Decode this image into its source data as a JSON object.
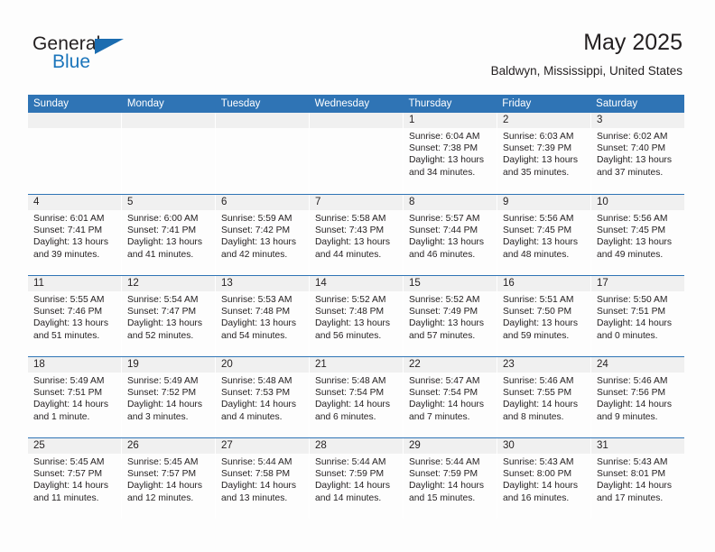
{
  "brand": {
    "line1": "General",
    "line2": "Blue",
    "triangle_color": "#1b6cb0",
    "text_color": "#231f20",
    "accent_color": "#1b75bb"
  },
  "header": {
    "title": "May 2025",
    "subtitle": "Baldwyn, Mississippi, United States"
  },
  "theme": {
    "header_bar_color": "#2f74b5",
    "day_number_band_color": "#f0f0f0",
    "page_background": "#fdfdfd",
    "text_color": "#231f20"
  },
  "weekdays": [
    "Sunday",
    "Monday",
    "Tuesday",
    "Wednesday",
    "Thursday",
    "Friday",
    "Saturday"
  ],
  "weeks": [
    [
      {
        "day": "",
        "empty": true,
        "sunrise": "",
        "sunset": "",
        "daylight_line1": "",
        "daylight_line2": ""
      },
      {
        "day": "",
        "empty": true,
        "sunrise": "",
        "sunset": "",
        "daylight_line1": "",
        "daylight_line2": ""
      },
      {
        "day": "",
        "empty": true,
        "sunrise": "",
        "sunset": "",
        "daylight_line1": "",
        "daylight_line2": ""
      },
      {
        "day": "",
        "empty": true,
        "sunrise": "",
        "sunset": "",
        "daylight_line1": "",
        "daylight_line2": ""
      },
      {
        "day": "1",
        "empty": false,
        "sunrise": "Sunrise: 6:04 AM",
        "sunset": "Sunset: 7:38 PM",
        "daylight_line1": "Daylight: 13 hours",
        "daylight_line2": "and 34 minutes."
      },
      {
        "day": "2",
        "empty": false,
        "sunrise": "Sunrise: 6:03 AM",
        "sunset": "Sunset: 7:39 PM",
        "daylight_line1": "Daylight: 13 hours",
        "daylight_line2": "and 35 minutes."
      },
      {
        "day": "3",
        "empty": false,
        "sunrise": "Sunrise: 6:02 AM",
        "sunset": "Sunset: 7:40 PM",
        "daylight_line1": "Daylight: 13 hours",
        "daylight_line2": "and 37 minutes."
      }
    ],
    [
      {
        "day": "4",
        "empty": false,
        "sunrise": "Sunrise: 6:01 AM",
        "sunset": "Sunset: 7:41 PM",
        "daylight_line1": "Daylight: 13 hours",
        "daylight_line2": "and 39 minutes."
      },
      {
        "day": "5",
        "empty": false,
        "sunrise": "Sunrise: 6:00 AM",
        "sunset": "Sunset: 7:41 PM",
        "daylight_line1": "Daylight: 13 hours",
        "daylight_line2": "and 41 minutes."
      },
      {
        "day": "6",
        "empty": false,
        "sunrise": "Sunrise: 5:59 AM",
        "sunset": "Sunset: 7:42 PM",
        "daylight_line1": "Daylight: 13 hours",
        "daylight_line2": "and 42 minutes."
      },
      {
        "day": "7",
        "empty": false,
        "sunrise": "Sunrise: 5:58 AM",
        "sunset": "Sunset: 7:43 PM",
        "daylight_line1": "Daylight: 13 hours",
        "daylight_line2": "and 44 minutes."
      },
      {
        "day": "8",
        "empty": false,
        "sunrise": "Sunrise: 5:57 AM",
        "sunset": "Sunset: 7:44 PM",
        "daylight_line1": "Daylight: 13 hours",
        "daylight_line2": "and 46 minutes."
      },
      {
        "day": "9",
        "empty": false,
        "sunrise": "Sunrise: 5:56 AM",
        "sunset": "Sunset: 7:45 PM",
        "daylight_line1": "Daylight: 13 hours",
        "daylight_line2": "and 48 minutes."
      },
      {
        "day": "10",
        "empty": false,
        "sunrise": "Sunrise: 5:56 AM",
        "sunset": "Sunset: 7:45 PM",
        "daylight_line1": "Daylight: 13 hours",
        "daylight_line2": "and 49 minutes."
      }
    ],
    [
      {
        "day": "11",
        "empty": false,
        "sunrise": "Sunrise: 5:55 AM",
        "sunset": "Sunset: 7:46 PM",
        "daylight_line1": "Daylight: 13 hours",
        "daylight_line2": "and 51 minutes."
      },
      {
        "day": "12",
        "empty": false,
        "sunrise": "Sunrise: 5:54 AM",
        "sunset": "Sunset: 7:47 PM",
        "daylight_line1": "Daylight: 13 hours",
        "daylight_line2": "and 52 minutes."
      },
      {
        "day": "13",
        "empty": false,
        "sunrise": "Sunrise: 5:53 AM",
        "sunset": "Sunset: 7:48 PM",
        "daylight_line1": "Daylight: 13 hours",
        "daylight_line2": "and 54 minutes."
      },
      {
        "day": "14",
        "empty": false,
        "sunrise": "Sunrise: 5:52 AM",
        "sunset": "Sunset: 7:48 PM",
        "daylight_line1": "Daylight: 13 hours",
        "daylight_line2": "and 56 minutes."
      },
      {
        "day": "15",
        "empty": false,
        "sunrise": "Sunrise: 5:52 AM",
        "sunset": "Sunset: 7:49 PM",
        "daylight_line1": "Daylight: 13 hours",
        "daylight_line2": "and 57 minutes."
      },
      {
        "day": "16",
        "empty": false,
        "sunrise": "Sunrise: 5:51 AM",
        "sunset": "Sunset: 7:50 PM",
        "daylight_line1": "Daylight: 13 hours",
        "daylight_line2": "and 59 minutes."
      },
      {
        "day": "17",
        "empty": false,
        "sunrise": "Sunrise: 5:50 AM",
        "sunset": "Sunset: 7:51 PM",
        "daylight_line1": "Daylight: 14 hours",
        "daylight_line2": "and 0 minutes."
      }
    ],
    [
      {
        "day": "18",
        "empty": false,
        "sunrise": "Sunrise: 5:49 AM",
        "sunset": "Sunset: 7:51 PM",
        "daylight_line1": "Daylight: 14 hours",
        "daylight_line2": "and 1 minute."
      },
      {
        "day": "19",
        "empty": false,
        "sunrise": "Sunrise: 5:49 AM",
        "sunset": "Sunset: 7:52 PM",
        "daylight_line1": "Daylight: 14 hours",
        "daylight_line2": "and 3 minutes."
      },
      {
        "day": "20",
        "empty": false,
        "sunrise": "Sunrise: 5:48 AM",
        "sunset": "Sunset: 7:53 PM",
        "daylight_line1": "Daylight: 14 hours",
        "daylight_line2": "and 4 minutes."
      },
      {
        "day": "21",
        "empty": false,
        "sunrise": "Sunrise: 5:48 AM",
        "sunset": "Sunset: 7:54 PM",
        "daylight_line1": "Daylight: 14 hours",
        "daylight_line2": "and 6 minutes."
      },
      {
        "day": "22",
        "empty": false,
        "sunrise": "Sunrise: 5:47 AM",
        "sunset": "Sunset: 7:54 PM",
        "daylight_line1": "Daylight: 14 hours",
        "daylight_line2": "and 7 minutes."
      },
      {
        "day": "23",
        "empty": false,
        "sunrise": "Sunrise: 5:46 AM",
        "sunset": "Sunset: 7:55 PM",
        "daylight_line1": "Daylight: 14 hours",
        "daylight_line2": "and 8 minutes."
      },
      {
        "day": "24",
        "empty": false,
        "sunrise": "Sunrise: 5:46 AM",
        "sunset": "Sunset: 7:56 PM",
        "daylight_line1": "Daylight: 14 hours",
        "daylight_line2": "and 9 minutes."
      }
    ],
    [
      {
        "day": "25",
        "empty": false,
        "sunrise": "Sunrise: 5:45 AM",
        "sunset": "Sunset: 7:57 PM",
        "daylight_line1": "Daylight: 14 hours",
        "daylight_line2": "and 11 minutes."
      },
      {
        "day": "26",
        "empty": false,
        "sunrise": "Sunrise: 5:45 AM",
        "sunset": "Sunset: 7:57 PM",
        "daylight_line1": "Daylight: 14 hours",
        "daylight_line2": "and 12 minutes."
      },
      {
        "day": "27",
        "empty": false,
        "sunrise": "Sunrise: 5:44 AM",
        "sunset": "Sunset: 7:58 PM",
        "daylight_line1": "Daylight: 14 hours",
        "daylight_line2": "and 13 minutes."
      },
      {
        "day": "28",
        "empty": false,
        "sunrise": "Sunrise: 5:44 AM",
        "sunset": "Sunset: 7:59 PM",
        "daylight_line1": "Daylight: 14 hours",
        "daylight_line2": "and 14 minutes."
      },
      {
        "day": "29",
        "empty": false,
        "sunrise": "Sunrise: 5:44 AM",
        "sunset": "Sunset: 7:59 PM",
        "daylight_line1": "Daylight: 14 hours",
        "daylight_line2": "and 15 minutes."
      },
      {
        "day": "30",
        "empty": false,
        "sunrise": "Sunrise: 5:43 AM",
        "sunset": "Sunset: 8:00 PM",
        "daylight_line1": "Daylight: 14 hours",
        "daylight_line2": "and 16 minutes."
      },
      {
        "day": "31",
        "empty": false,
        "sunrise": "Sunrise: 5:43 AM",
        "sunset": "Sunset: 8:01 PM",
        "daylight_line1": "Daylight: 14 hours",
        "daylight_line2": "and 17 minutes."
      }
    ]
  ]
}
